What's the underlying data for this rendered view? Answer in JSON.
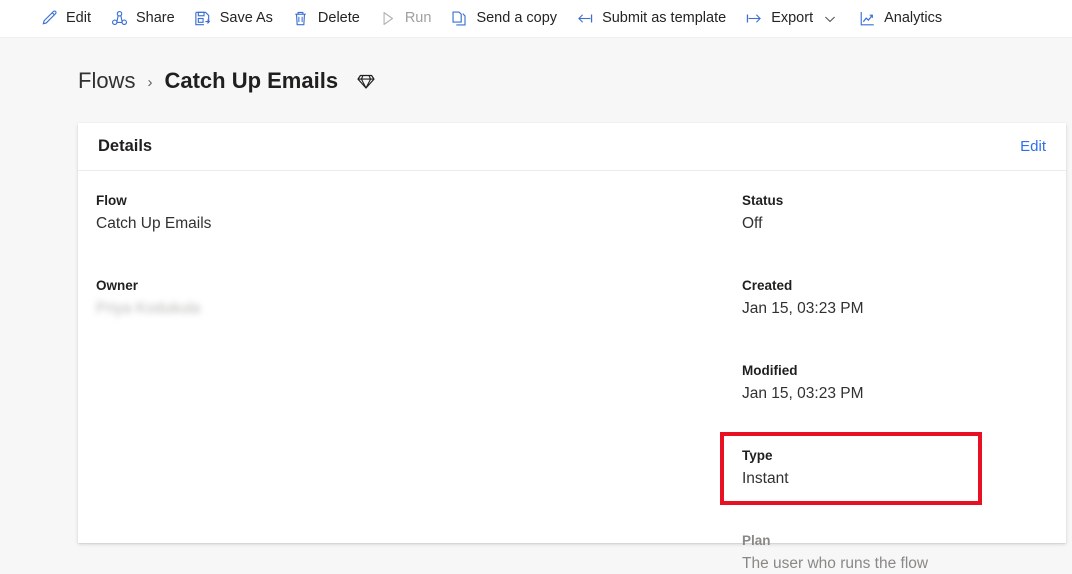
{
  "commandbar": {
    "items": [
      {
        "id": "edit",
        "label": "Edit",
        "icon": "pencil-icon",
        "disabled": false,
        "chevron": false
      },
      {
        "id": "share",
        "label": "Share",
        "icon": "share-nodes-icon",
        "disabled": false,
        "chevron": false
      },
      {
        "id": "save-as",
        "label": "Save As",
        "icon": "save-as-icon",
        "disabled": false,
        "chevron": false
      },
      {
        "id": "delete",
        "label": "Delete",
        "icon": "trash-icon",
        "disabled": false,
        "chevron": false
      },
      {
        "id": "run",
        "label": "Run",
        "icon": "play-icon",
        "disabled": true,
        "chevron": false
      },
      {
        "id": "send-copy",
        "label": "Send a copy",
        "icon": "copy-icon",
        "disabled": false,
        "chevron": false
      },
      {
        "id": "submit-template",
        "label": "Submit as template",
        "icon": "arrow-left-to-bar-icon",
        "disabled": false,
        "chevron": false
      },
      {
        "id": "export",
        "label": "Export",
        "icon": "arrow-right-from-bar-icon",
        "disabled": false,
        "chevron": true
      },
      {
        "id": "analytics",
        "label": "Analytics",
        "icon": "line-chart-icon",
        "disabled": false,
        "chevron": false
      }
    ]
  },
  "breadcrumb": {
    "root_label": "Flows",
    "separator": "›",
    "current_label": "Catch Up Emails",
    "premium_icon": "gem-icon"
  },
  "details_card": {
    "title": "Details",
    "edit_label": "Edit",
    "left_fields": [
      {
        "label": "Flow",
        "value": "Catch Up Emails"
      },
      {
        "label": "Owner",
        "value": "Priya Kodukula"
      }
    ],
    "right_fields": [
      {
        "label": "Status",
        "value": "Off"
      },
      {
        "label": "Created",
        "value": "Jan 15, 03:23 PM"
      },
      {
        "label": "Modified",
        "value": "Jan 15, 03:23 PM"
      },
      {
        "label": "Type",
        "value": "Instant"
      }
    ],
    "plan_field": {
      "label": "Plan",
      "value": "The user who runs the flow"
    }
  },
  "annotation": {
    "color": "#e81123",
    "target": "plan-field"
  },
  "colors": {
    "accent_blue": "#2f6fed",
    "icon_blue": "#3b6fd4",
    "page_bg": "#f7f7f7",
    "card_bg": "#ffffff",
    "text_primary": "#201f1e",
    "text_muted": "#8a8886",
    "disabled": "#a19f9d",
    "annotation_red": "#e81123"
  }
}
